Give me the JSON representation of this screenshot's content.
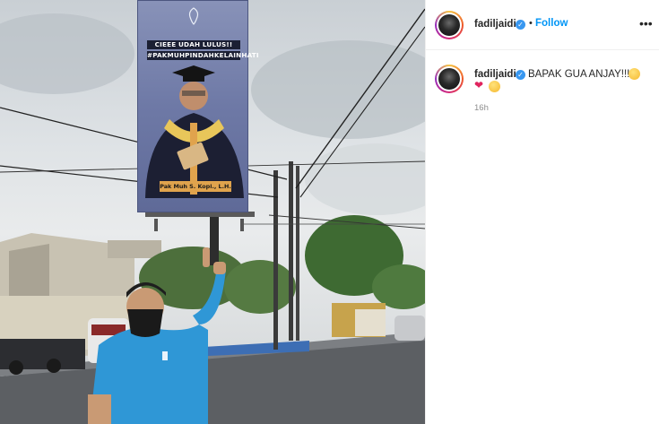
{
  "post": {
    "username": "fadiljaidi",
    "verified_icon": "check",
    "separator": "•",
    "follow_label": "Follow",
    "more_label": "•••"
  },
  "caption": {
    "username": "fadiljaidi",
    "text": "BAPAK GUA ANJAY!!!!!!",
    "emojis": [
      "grinning-face-with-sweat",
      "red-heart",
      "grinning-face-with-sweat"
    ],
    "heart": "❤",
    "time": "16h"
  },
  "photo": {
    "billboard_headline_1": "CIEEE UDAH LULUS!!",
    "billboard_headline_2": "#PAKMUHPINDAHKELAINHATI",
    "billboard_name": "Pak Muh S. Kopi., L.H."
  },
  "colors": {
    "accent": "#0095f6",
    "verified": "#3897f0",
    "heart": "#e0245e",
    "muted": "#8e8e8e"
  }
}
